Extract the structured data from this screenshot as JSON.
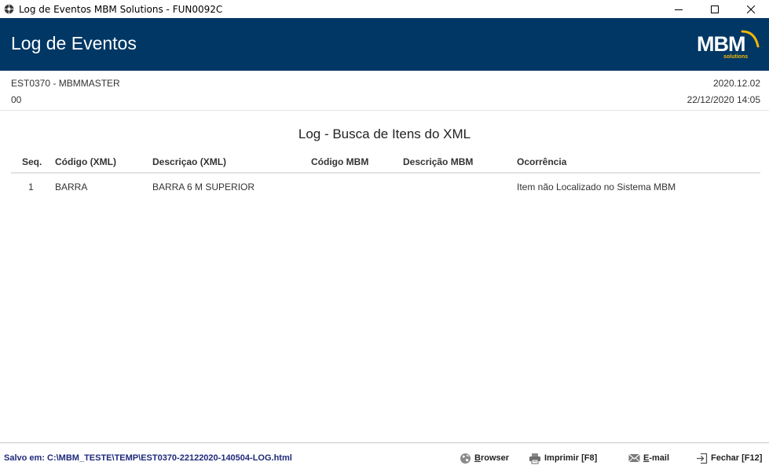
{
  "window": {
    "title": "Log de Eventos MBM Solutions - FUN0092C",
    "app_icon": "gear-icon",
    "controls": [
      "minimize-icon",
      "maximize-icon",
      "close-icon"
    ]
  },
  "header": {
    "title": "Log de Eventos",
    "logo_text": "MBM",
    "logo_subtext": "solutions",
    "logo_arc_color": "#f2b705"
  },
  "info": {
    "left_line1": "EST0370 - MBMMASTER",
    "left_line2": "00",
    "right_line1": "2020.12.02",
    "right_line2": "22/12/2020 14:05"
  },
  "report": {
    "title": "Log - Busca de Itens do XML",
    "columns": [
      "Seq.",
      "Código (XML)",
      "Descriçao (XML)",
      "Código MBM",
      "Descrição MBM",
      "Ocorrência"
    ],
    "rows": [
      [
        "1",
        "BARRA",
        "BARRA 6 M SUPERIOR",
        "",
        "",
        "Item não Localizado no Sistema MBM"
      ]
    ]
  },
  "status": {
    "saved_path": "Salvo em: C:\\MBM_TESTE\\TEMP\\EST0370-22122020-140504-LOG.html",
    "browser_first": "B",
    "browser_rest": "rowser",
    "print_label": "Imprimir [F8]",
    "email_first": "E",
    "email_rest": "-mail",
    "close_label": "Fechar [F12]"
  },
  "colors": {
    "header_bg": "#003764",
    "status_path": "#1f2a7a"
  }
}
